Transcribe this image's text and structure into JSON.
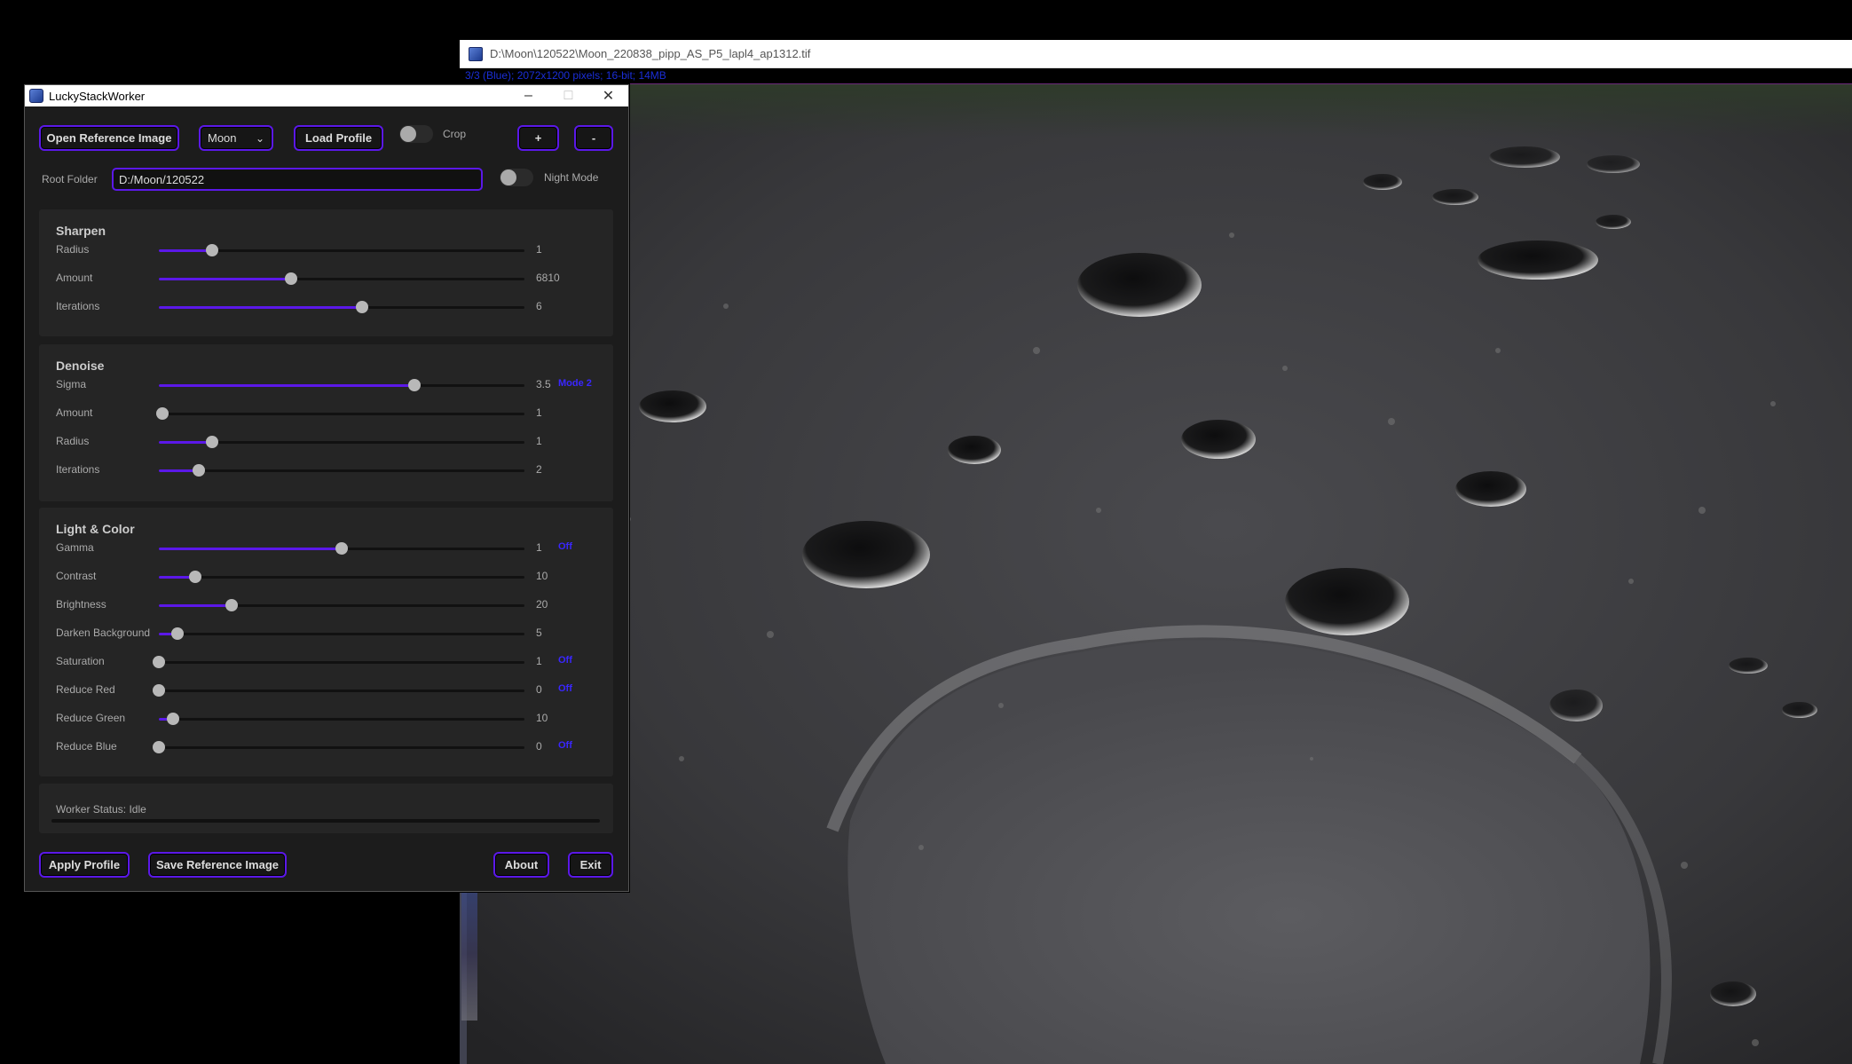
{
  "viewer": {
    "title": "D:\\Moon\\120522\\Moon_220838_pipp_AS_P5_lapl4_ap1312.tif",
    "info": "3/3 (Blue); 2072x1200 pixels; 16-bit; 14MB"
  },
  "app": {
    "title": "LuckyStackWorker",
    "window_controls": {
      "minimize": "–",
      "maximize": "□",
      "close": "✕"
    }
  },
  "toolbar": {
    "open_reference": "Open Reference Image",
    "profile_select": "Moon",
    "load_profile": "Load Profile",
    "crop_label": "Crop",
    "plus": "+",
    "minus": "-"
  },
  "root": {
    "label": "Root Folder",
    "value": "D:/Moon/120522",
    "night_mode_label": "Night Mode"
  },
  "sections": {
    "sharpen": {
      "title": "Sharpen",
      "rows": [
        {
          "label": "Radius",
          "value": "1",
          "fraction": 0.145,
          "badge": ""
        },
        {
          "label": "Amount",
          "value": "6810",
          "fraction": 0.362,
          "badge": ""
        },
        {
          "label": "Iterations",
          "value": "6",
          "fraction": 0.555,
          "badge": ""
        }
      ]
    },
    "denoise": {
      "title": "Denoise",
      "rows": [
        {
          "label": "Sigma",
          "value": "3.5",
          "fraction": 0.7,
          "badge": "Mode 2"
        },
        {
          "label": "Amount",
          "value": "1",
          "fraction": 0.01,
          "badge": ""
        },
        {
          "label": "Radius",
          "value": "1",
          "fraction": 0.145,
          "badge": ""
        },
        {
          "label": "Iterations",
          "value": "2",
          "fraction": 0.11,
          "badge": ""
        }
      ]
    },
    "light": {
      "title": "Light & Color",
      "rows": [
        {
          "label": "Gamma",
          "value": "1",
          "fraction": 0.5,
          "badge": "Off"
        },
        {
          "label": "Contrast",
          "value": "10",
          "fraction": 0.1,
          "badge": ""
        },
        {
          "label": "Brightness",
          "value": "20",
          "fraction": 0.2,
          "badge": ""
        },
        {
          "label": "Darken Background",
          "value": "5",
          "fraction": 0.05,
          "badge": ""
        },
        {
          "label": "Saturation",
          "value": "1",
          "fraction": 0.0,
          "badge": "Off"
        },
        {
          "label": "Reduce Red",
          "value": "0",
          "fraction": 0.0,
          "badge": "Off"
        },
        {
          "label": "Reduce Green",
          "value": "10",
          "fraction": 0.04,
          "badge": ""
        },
        {
          "label": "Reduce Blue",
          "value": "0",
          "fraction": 0.0,
          "badge": "Off"
        }
      ]
    }
  },
  "status": {
    "text": "Worker Status: Idle"
  },
  "footer": {
    "apply_profile": "Apply Profile",
    "save_reference": "Save Reference Image",
    "about": "About",
    "exit": "Exit"
  },
  "colors": {
    "accent": "#5b18e8",
    "badge": "#3a26ff",
    "window_bg": "#1c1c1c",
    "panel_bg": "#252525"
  }
}
